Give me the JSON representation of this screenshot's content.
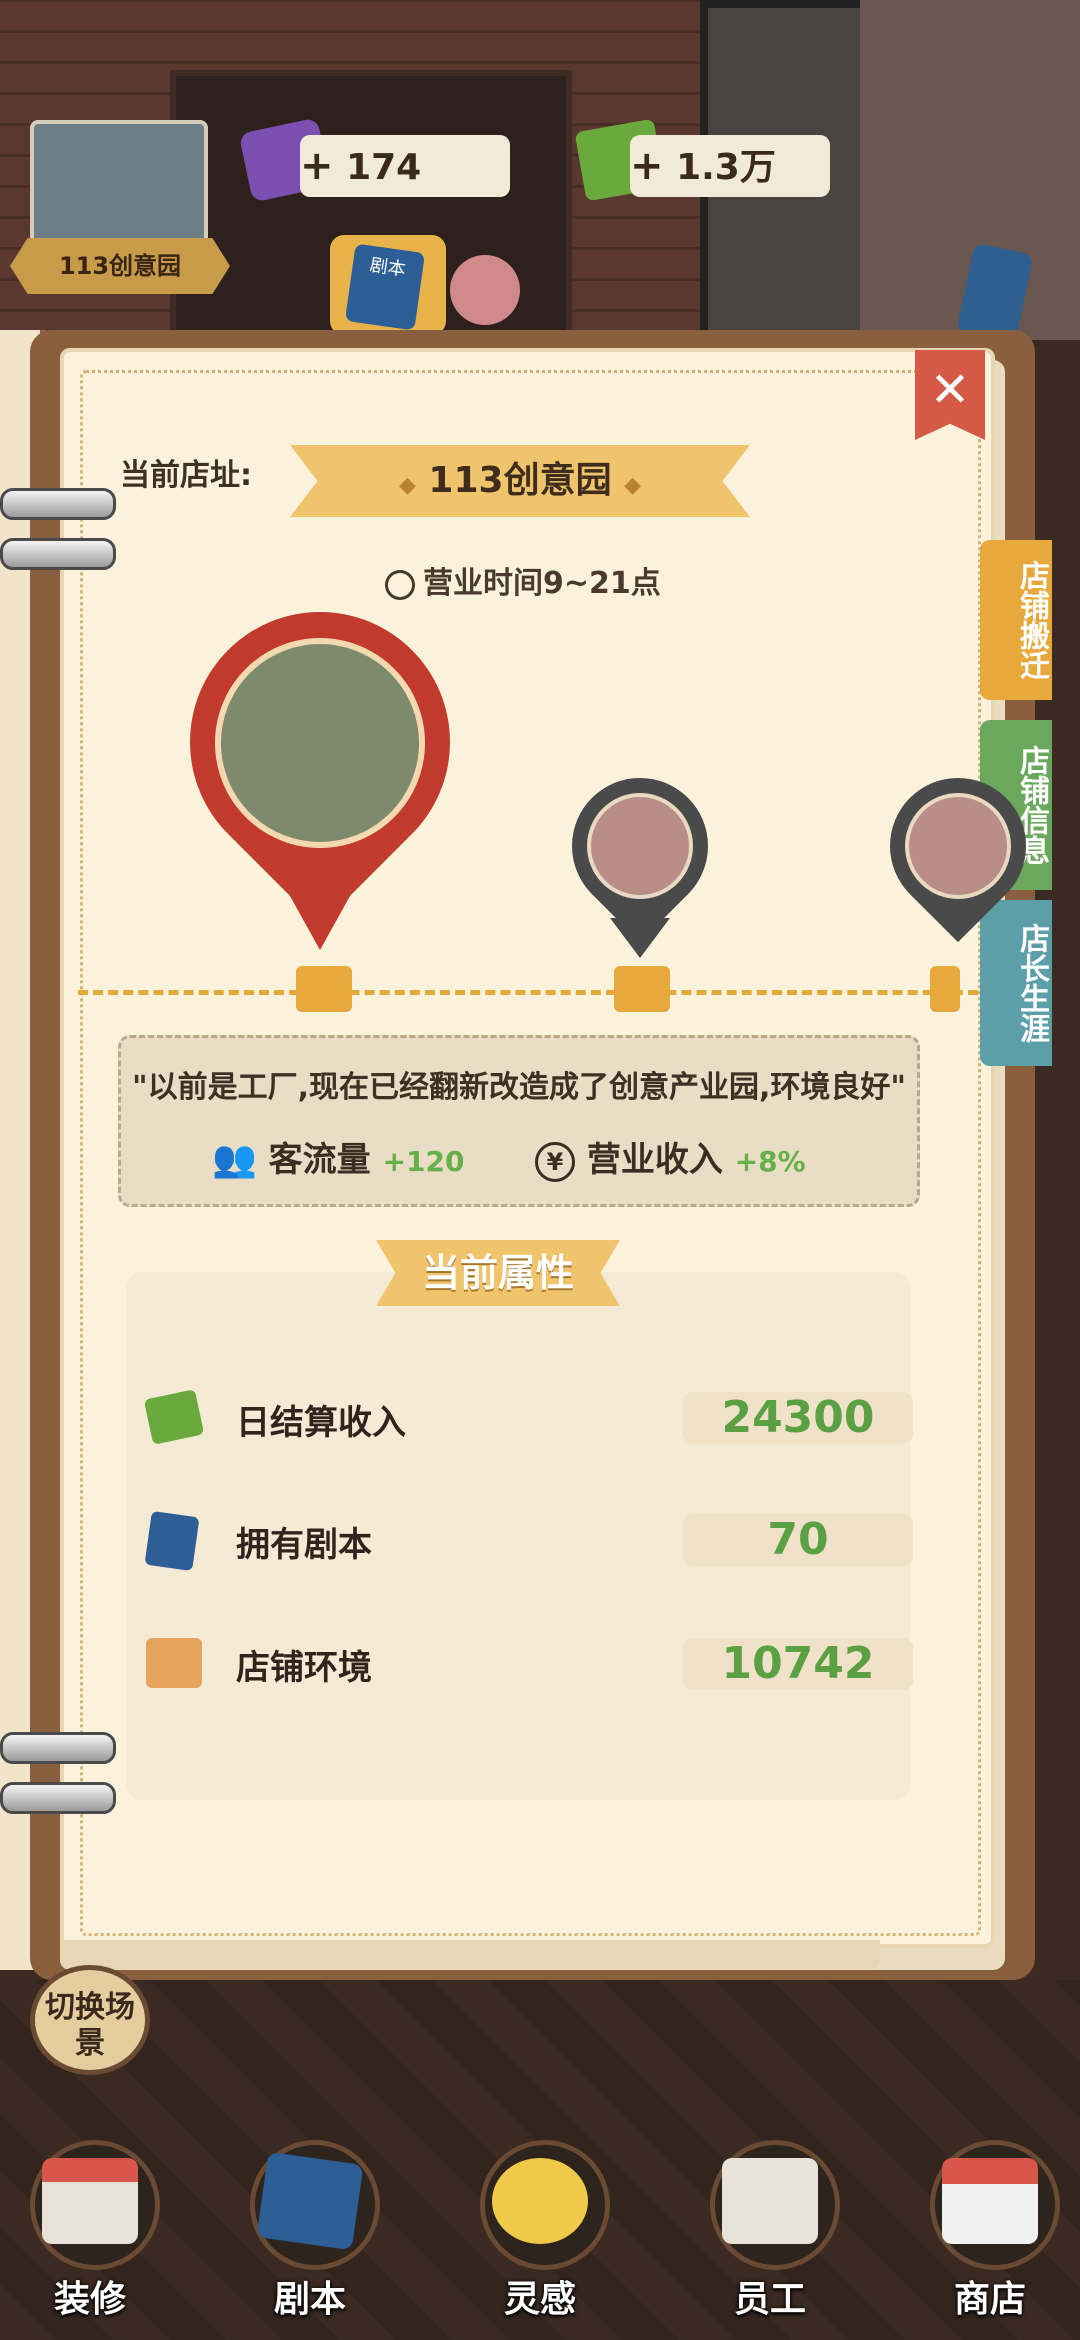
{
  "top_bar": {
    "store_name": "113创意园",
    "gems": "174",
    "cash": "1.3万",
    "plus": "+",
    "script_badge": "剧本"
  },
  "panel": {
    "close_icon": "✕",
    "side_tabs": [
      {
        "label": "店铺搬迁",
        "color": "#e8a93c"
      },
      {
        "label": "店铺信息",
        "color": "#6aa85e"
      },
      {
        "label": "店长生涯",
        "color": "#5d9fa8"
      }
    ],
    "current_address_label": "当前店址:",
    "current_address": "113创意园",
    "hours": "营业时间9~21点",
    "description": "\"以前是工厂,现在已经翻新改造成了创意产业园,环境良好\"",
    "bonuses": [
      {
        "label": "客流量",
        "value": "+120",
        "icon": "people-icon"
      },
      {
        "label": "营业收入",
        "value": "+8%",
        "icon": "yen-icon"
      }
    ],
    "attributes_title": "当前属性",
    "attributes": [
      {
        "label": "日结算收入",
        "value": "24300",
        "icon": "cash-icon"
      },
      {
        "label": "拥有剧本",
        "value": "70",
        "icon": "book-icon"
      },
      {
        "label": "店铺环境",
        "value": "10742",
        "icon": "house-icon"
      }
    ]
  },
  "switch_scene": "切换场景",
  "bottom_nav": [
    {
      "label": "装修"
    },
    {
      "label": "剧本"
    },
    {
      "label": "灵感"
    },
    {
      "label": "员工"
    },
    {
      "label": "商店"
    }
  ]
}
